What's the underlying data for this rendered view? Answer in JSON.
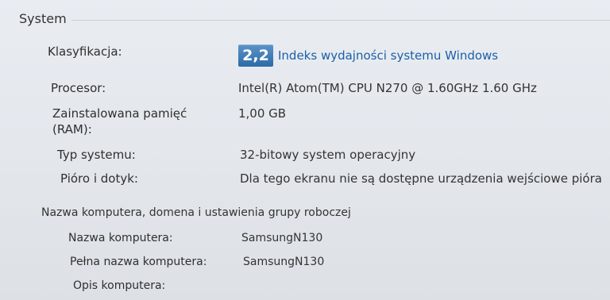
{
  "section": {
    "title": "System"
  },
  "rating": {
    "label": "Klasyfikacja:",
    "score": "2,2",
    "link_text": "Indeks wydajności systemu Windows"
  },
  "processor": {
    "label": "Procesor:",
    "value": "Intel(R) Atom(TM) CPU N270   @ 1.60GHz   1.60 GHz"
  },
  "memory": {
    "label_line1": "Zainstalowana pamięć",
    "label_line2": "(RAM):",
    "value": "1,00 GB"
  },
  "system_type": {
    "label": "Typ systemu:",
    "value": "32-bitowy system operacyjny"
  },
  "pen_touch": {
    "label": "Pióro i dotyk:",
    "value": "Dla tego ekranu nie są dostępne urządzenia wejściowe pióra"
  },
  "computer_section": {
    "title": "Nazwa komputera, domena i ustawienia grupy roboczej",
    "computer_name_label": "Nazwa komputera:",
    "computer_name_value": "SamsungN130",
    "full_name_label": "Pełna nazwa komputera:",
    "full_name_value": "SamsungN130",
    "description_label": "Opis komputera:"
  },
  "colors": {
    "badge": "#2d6aa6",
    "link": "#1c5fa8"
  }
}
